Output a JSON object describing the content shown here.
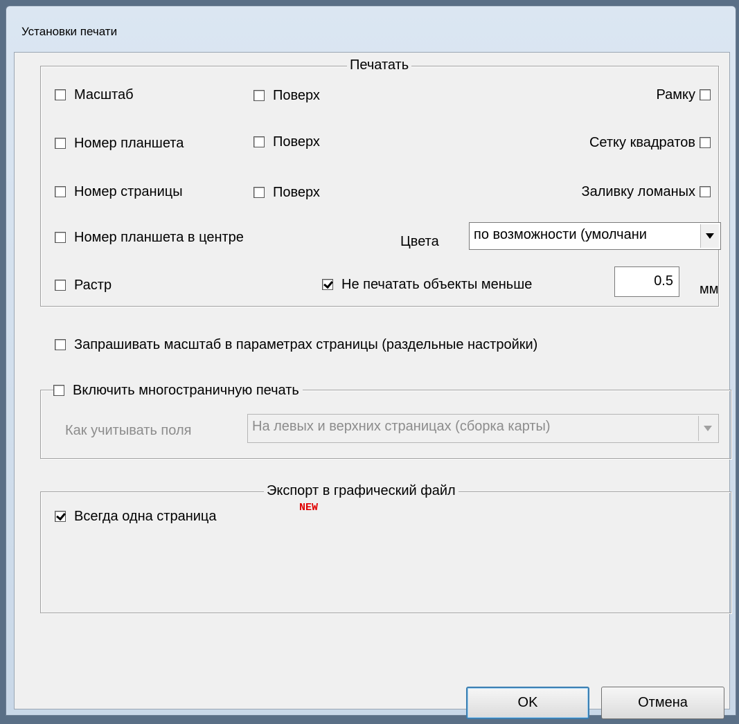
{
  "window": {
    "title": "Установки печати"
  },
  "print_group": {
    "legend": "Печатать",
    "scale": {
      "label": "Масштаб",
      "checked": false
    },
    "scale_on_top": {
      "label": "Поверх",
      "checked": false
    },
    "sheet_number": {
      "label": "Номер планшета",
      "checked": false
    },
    "sheet_on_top": {
      "label": "Поверх",
      "checked": false
    },
    "page_number": {
      "label": "Номер страницы",
      "checked": false
    },
    "page_on_top": {
      "label": "Поверх",
      "checked": false
    },
    "sheet_center": {
      "label": "Номер планшета в центре",
      "checked": false
    },
    "raster": {
      "label": "Растр",
      "checked": false
    },
    "frame": {
      "label": "Рамку",
      "checked": false
    },
    "grid": {
      "label": "Сетку квадратов",
      "checked": false
    },
    "fill": {
      "label": "Заливку ломаных",
      "checked": false
    },
    "colors": {
      "label": "Цвета",
      "value": "по возможности (умолчани"
    },
    "skip_small": {
      "label": "Не печатать объекты меньше",
      "checked": true,
      "value": "0.5",
      "unit": "мм"
    }
  },
  "ask_scale": {
    "label": "Запрашивать масштаб в параметрах страницы (раздельные настройки)",
    "checked": false
  },
  "multipage": {
    "label": "Включить многостраничную печать",
    "checked": false,
    "margins_label": "Как учитывать поля",
    "margins_value": "На левых и верхних страницах (сборка карты)"
  },
  "export": {
    "legend": "Экспорт в графический файл",
    "one_page": {
      "label": "Всегда одна страница",
      "checked": true
    },
    "new_badge": "NEW"
  },
  "buttons": {
    "ok": "OK",
    "cancel": "Отмена"
  }
}
